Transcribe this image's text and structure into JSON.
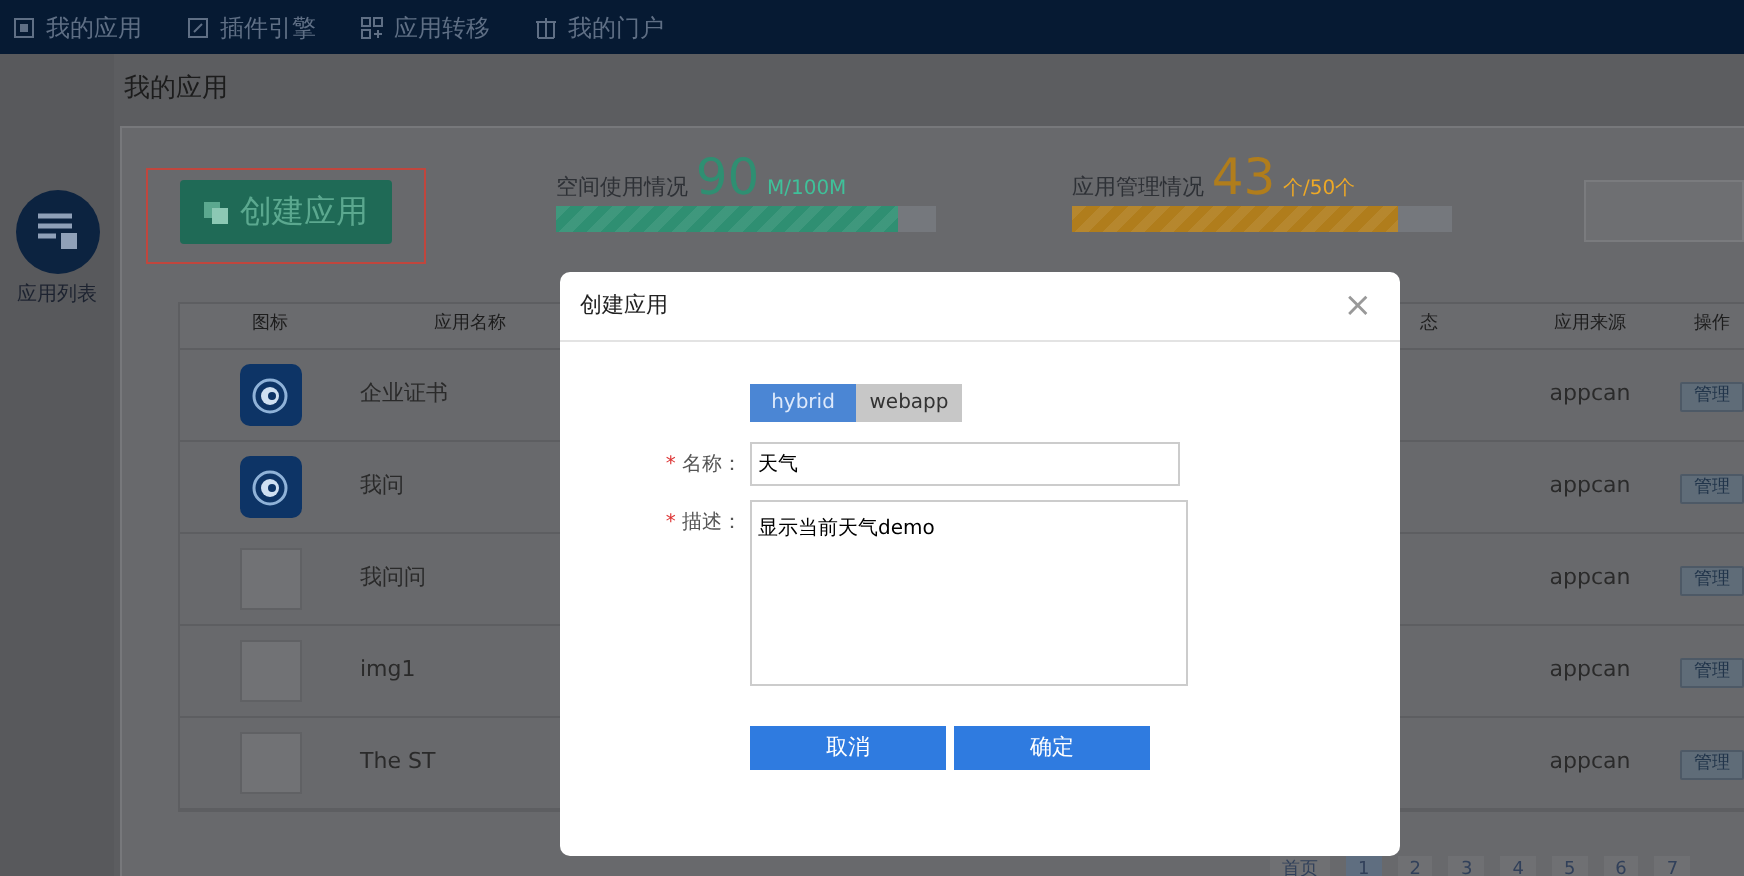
{
  "top_nav": [
    {
      "label": "我的应用"
    },
    {
      "label": "插件引擎"
    },
    {
      "label": "应用转移"
    },
    {
      "label": "我的门户"
    }
  ],
  "sidebar": {
    "items": [
      {
        "label": "应用列表",
        "selected": true
      }
    ]
  },
  "page_title": "我的应用",
  "create_button": "创建应用",
  "stats": [
    {
      "label": "空间使用情况",
      "value": "90",
      "unit": "M/100M",
      "level": 0.9,
      "color": "#2f8f72"
    },
    {
      "label": "应用管理情况",
      "value": "43",
      "unit": "个/50个",
      "level": 0.86,
      "color": "#b07d1c"
    }
  ],
  "table": {
    "columns": [
      "图标",
      "应用名称",
      "态",
      "应用来源",
      "操作"
    ],
    "rows": [
      {
        "kind": "app",
        "name": "企业证书",
        "source": "appcan",
        "action": "管理"
      },
      {
        "kind": "app",
        "name": "我问",
        "source": "appcan",
        "action": "管理"
      },
      {
        "kind": "broken",
        "name": "我问问",
        "source": "appcan",
        "action": "管理"
      },
      {
        "kind": "broken",
        "name": "img1",
        "source": "appcan",
        "action": "管理"
      },
      {
        "kind": "broken",
        "name": "The ST",
        "source": "appcan",
        "action": "管理"
      }
    ]
  },
  "pagination": [
    {
      "label": "首页",
      "selected": false
    },
    {
      "label": "1",
      "selected": true
    },
    {
      "label": "2",
      "selected": false
    },
    {
      "label": "3",
      "selected": false
    },
    {
      "label": "4",
      "selected": false
    },
    {
      "label": "5",
      "selected": false
    },
    {
      "label": "6",
      "selected": false
    },
    {
      "label": "7",
      "selected": false
    }
  ],
  "dialog": {
    "title": "创建应用",
    "close": "×",
    "tabs": [
      {
        "label": "hybrid",
        "selected": true
      },
      {
        "label": "webapp",
        "selected": false
      }
    ],
    "fields": [
      {
        "kind": "input",
        "required_mark": "*",
        "label": "名称：",
        "value": "天气"
      },
      {
        "kind": "textarea",
        "required_mark": "*",
        "label": "描述：",
        "value": "显示当前天气demo"
      }
    ],
    "buttons": [
      "取消",
      "确定"
    ]
  }
}
